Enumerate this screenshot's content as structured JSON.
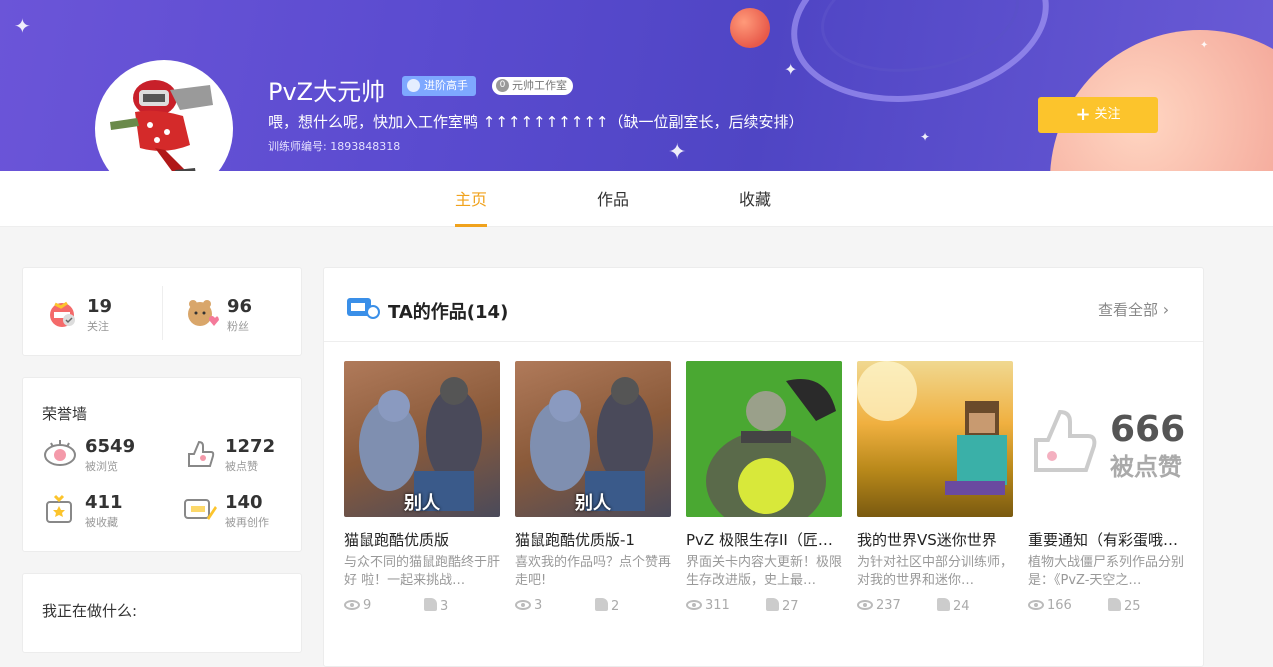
{
  "profile": {
    "name": "PvZ大元帅",
    "badge_level": "进阶高手",
    "badge_studio": "元帅工作室",
    "motto": "喂，想什么呢，快加入工作室鸭 ↑↑↑↑↑↑↑↑↑↑（缺一位副室长，后续安排）",
    "trainer_id": "训练师编号: 1893848318",
    "follow_label": "关注"
  },
  "tabs": [
    "主页",
    "作品",
    "收藏"
  ],
  "social": {
    "following": {
      "value": "19",
      "label": "关注"
    },
    "fans": {
      "value": "96",
      "label": "粉丝"
    }
  },
  "honor": {
    "title": "荣誉墙",
    "views": {
      "value": "6549",
      "label": "被浏览"
    },
    "likes": {
      "value": "1272",
      "label": "被点赞"
    },
    "favorites": {
      "value": "411",
      "label": "被收藏"
    },
    "remix": {
      "value": "140",
      "label": "被再创作"
    }
  },
  "doing": {
    "title": "我正在做什么:"
  },
  "works": {
    "title": "TA的作品(14)",
    "view_all": "查看全部",
    "items": [
      {
        "title": "猫鼠跑酷优质版",
        "desc": "与众不同的猫鼠跑酷终于肝 好 啦！一起来挑战…",
        "views": "9",
        "likes": "3",
        "thumb_text": "别人"
      },
      {
        "title": "猫鼠跑酷优质版-1",
        "desc": "喜欢我的作品吗？点个赞再走吧!",
        "views": "3",
        "likes": "2",
        "thumb_text": "别人"
      },
      {
        "title": "PvZ 极限生存II（匠…",
        "desc": "界面关卡内容大更新！极限生存改进版，史上最…",
        "views": "311",
        "likes": "27"
      },
      {
        "title": "我的世界VS迷你世界",
        "desc": "为针对社区中部分训练师，对我的世界和迷你…",
        "views": "237",
        "likes": "24"
      },
      {
        "title": "重要通知（有彩蛋哦…",
        "desc": "植物大战僵尸系列作品分别是：《PvZ-天空之…",
        "views": "166",
        "likes": "25",
        "thumb_num": "666",
        "thumb_label": "被点赞"
      }
    ]
  },
  "colors": {
    "accent": "#f0a21c",
    "follow_button": "#fcc42c",
    "banner": "#5a4bcf"
  }
}
